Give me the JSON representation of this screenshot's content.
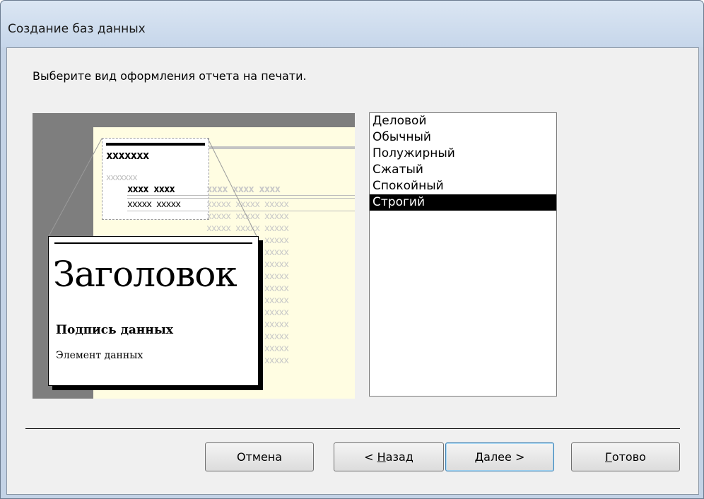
{
  "window": {
    "title": "Создание баз данных"
  },
  "instruction": "Выберите вид оформления отчета на печати.",
  "preview": {
    "sample_title": "xxxxxxx",
    "sample_subtitle": "xxxxxxx",
    "header_bold": "xxxx xxxx",
    "header_gray": "xxxx xxxx xxxx",
    "row_bold": "xxxxx xxxxx",
    "row_gray": "xxxxx xxxxx xxxxx",
    "label_heading": "Заголовок",
    "label_caption": "Подпись данных",
    "label_item": "Элемент данных"
  },
  "styles": {
    "options": [
      "Деловой",
      "Обычный",
      "Полужирный",
      "Сжатый",
      "Спокойный",
      "Строгий"
    ],
    "selected": "Строгий"
  },
  "buttons": {
    "cancel": "Отмена",
    "back_prefix": "< ",
    "back_key": "Н",
    "back_rest": "азад",
    "next_key": "Д",
    "next_rest": "алее >",
    "finish_key": "Г",
    "finish_rest": "отово"
  }
}
